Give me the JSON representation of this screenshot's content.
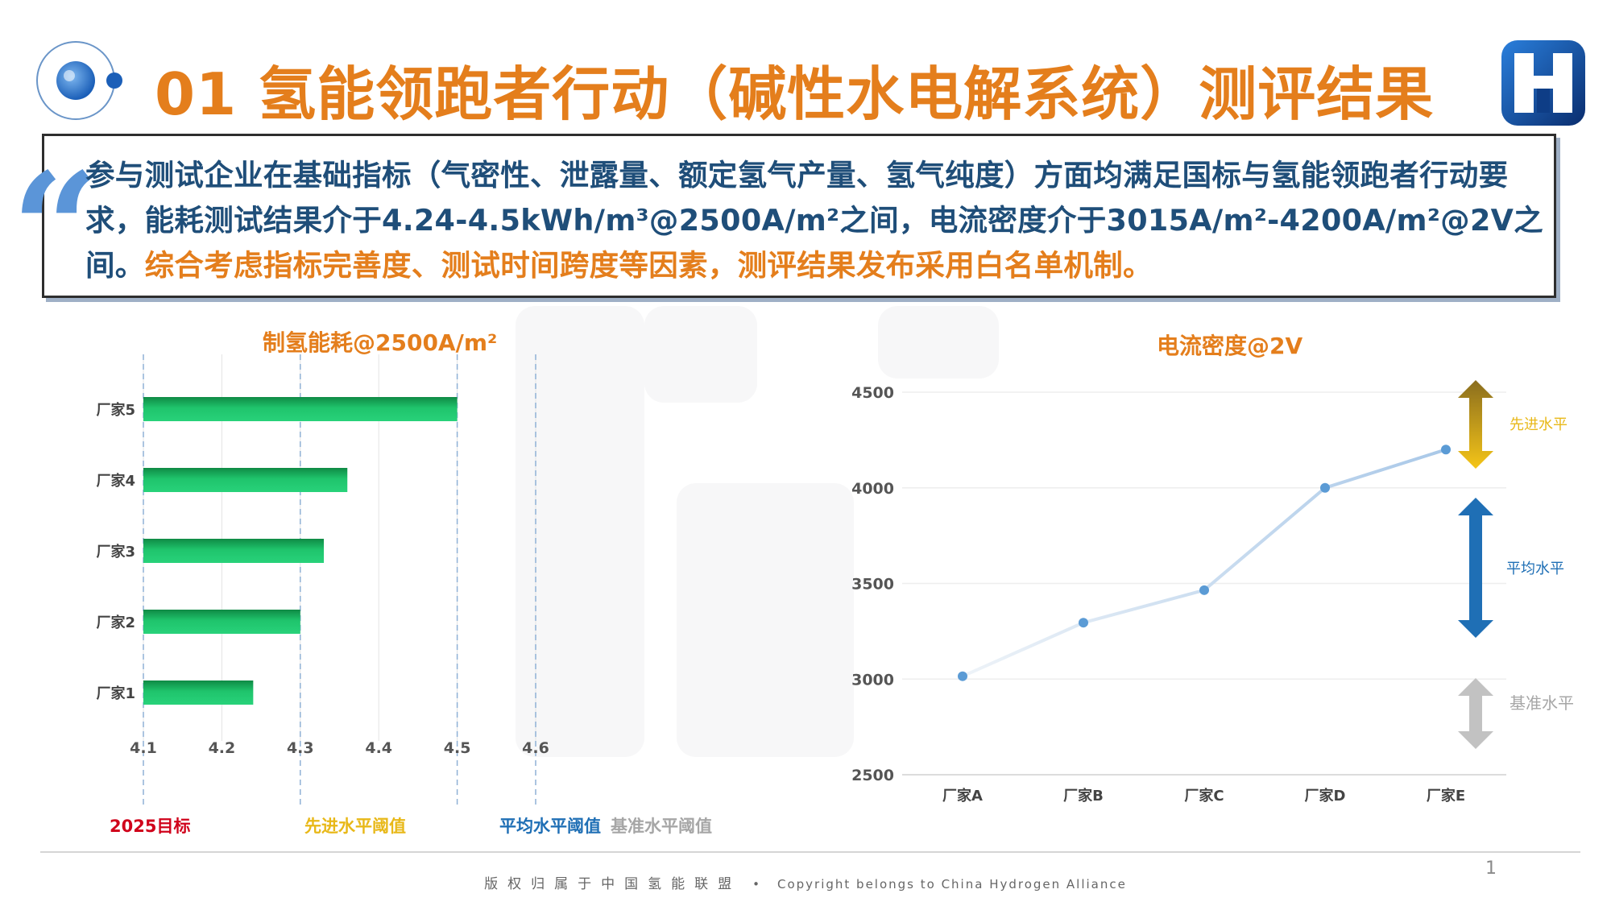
{
  "title": "01 氢能领跑者行动（碱性水电解系统）测评结果",
  "quote": {
    "mark": "“",
    "text_main": "参与测试企业在基础指标（气密性、泄露量、额定氢气产量、氢气纯度）方面均满足国标与氢能领跑者行动要求，能耗测试结果介于4.24-4.5kWh/m³@2500A/m²之间，电流密度介于3015A/m²-4200A/m²@2V之间。",
    "text_highlight": "综合考虑指标完善度、测试时间跨度等因素，测评结果发布采用白名单机制。"
  },
  "colors": {
    "accent_orange": "#e47e1c",
    "text_blue": "#1f4e79",
    "target_red": "#d0021b",
    "advanced_gold": "#e8b818",
    "average_blue": "#1f6fb5",
    "baseline_gray": "#a6a6a6",
    "bar_green": "#1cc36a",
    "line_blue": "#5b9bd5"
  },
  "chart_data": [
    {
      "type": "bar",
      "orientation": "horizontal",
      "title": "制氢能耗@2500A/m²",
      "categories": [
        "厂家5",
        "厂家4",
        "厂家3",
        "厂家2",
        "厂家1"
      ],
      "values": [
        4.5,
        4.36,
        4.33,
        4.3,
        4.24
      ],
      "xlim": [
        4.1,
        4.6
      ],
      "xticks": [
        "4.1",
        "4.2",
        "4.3",
        "4.4",
        "4.5",
        "4.6"
      ],
      "grid": "vertical",
      "thresholds": [
        {
          "label": "2025目标",
          "value": 4.1,
          "color": "#d0021b"
        },
        {
          "label": "先进水平阈值",
          "value": 4.3,
          "color": "#e8b818"
        },
        {
          "label": "平均水平阈值",
          "value": 4.5,
          "color": "#1f6fb5"
        },
        {
          "label": "基准水平阈值",
          "value": 4.6,
          "color": "#a6a6a6"
        }
      ]
    },
    {
      "type": "line",
      "title": "电流密度@2V",
      "categories": [
        "厂家A",
        "厂家B",
        "厂家C",
        "厂家D",
        "厂家E"
      ],
      "values": [
        3015,
        3295,
        3465,
        4000,
        4200
      ],
      "ylim": [
        2500,
        4500
      ],
      "yticks": [
        "2500",
        "3000",
        "3500",
        "4000",
        "4500"
      ],
      "grid": "horizontal",
      "levels": [
        {
          "label": "先进水平",
          "color": "#e8b818",
          "style": "gradient-double-arrow"
        },
        {
          "label": "平均水平",
          "color": "#1f6fb5",
          "style": "double-arrow"
        },
        {
          "label": "基准水平",
          "color": "#a6a6a6",
          "style": "double-arrow"
        }
      ]
    }
  ],
  "footer": {
    "copyright_cn": "版权归属于中国氢能联盟",
    "separator": "•",
    "copyright_en": "Copyright belongs to China Hydrogen Alliance",
    "page_number": "1"
  }
}
